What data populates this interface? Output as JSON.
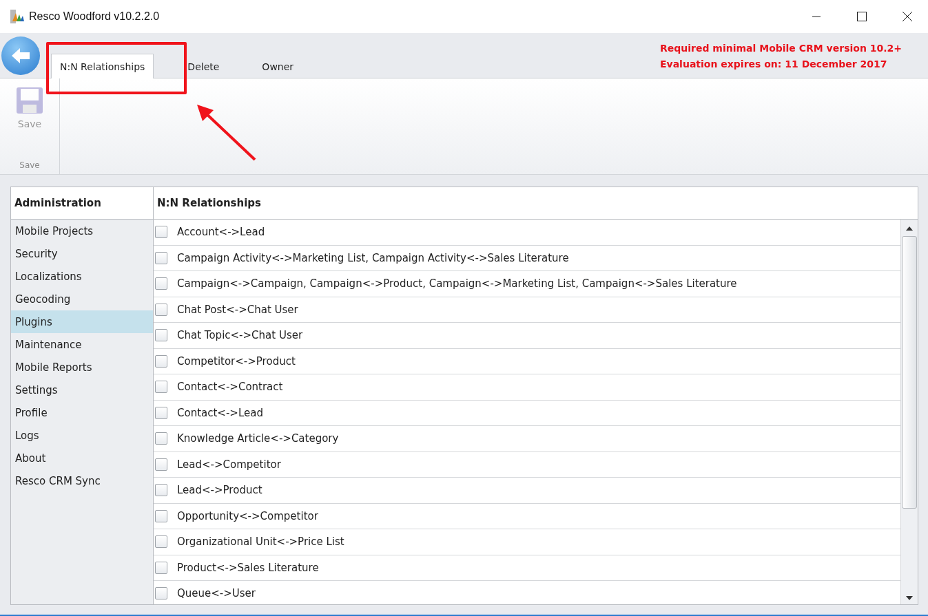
{
  "window": {
    "title": "Resco Woodford v10.2.2.0"
  },
  "tabs": [
    {
      "label": "N:N Relationships",
      "selected": true
    },
    {
      "label": "Delete",
      "selected": false
    },
    {
      "label": "Owner",
      "selected": false
    }
  ],
  "notices": [
    "Required minimal Mobile CRM version 10.2+",
    "Evaluation expires on: 11 December 2017"
  ],
  "ribbon": {
    "buttons": [
      {
        "label": "Save",
        "disabled": true
      }
    ],
    "group_label": "Save"
  },
  "sidebar": {
    "title": "Administration",
    "items": [
      {
        "label": "Mobile Projects",
        "selected": false
      },
      {
        "label": "Security",
        "selected": false
      },
      {
        "label": "Localizations",
        "selected": false
      },
      {
        "label": "Geocoding",
        "selected": false
      },
      {
        "label": "Plugins",
        "selected": true
      },
      {
        "label": "Maintenance",
        "selected": false
      },
      {
        "label": "Mobile Reports",
        "selected": false
      },
      {
        "label": "Settings",
        "selected": false
      },
      {
        "label": "Profile",
        "selected": false
      },
      {
        "label": "Logs",
        "selected": false
      },
      {
        "label": "About",
        "selected": false
      },
      {
        "label": "Resco CRM Sync",
        "selected": false
      }
    ]
  },
  "list": {
    "title": "N:N Relationships",
    "rows": [
      {
        "label": "Account<->Lead",
        "checked": false
      },
      {
        "label": "Campaign Activity<->Marketing List, Campaign Activity<->Sales Literature",
        "checked": false
      },
      {
        "label": "Campaign<->Campaign, Campaign<->Product, Campaign<->Marketing List, Campaign<->Sales Literature",
        "checked": false
      },
      {
        "label": "Chat Post<->Chat User",
        "checked": false
      },
      {
        "label": "Chat Topic<->Chat User",
        "checked": false
      },
      {
        "label": "Competitor<->Product",
        "checked": false
      },
      {
        "label": "Contact<->Contract",
        "checked": false
      },
      {
        "label": "Contact<->Lead",
        "checked": false
      },
      {
        "label": "Knowledge Article<->Category",
        "checked": false
      },
      {
        "label": "Lead<->Competitor",
        "checked": false
      },
      {
        "label": "Lead<->Product",
        "checked": false
      },
      {
        "label": "Opportunity<->Competitor",
        "checked": false
      },
      {
        "label": "Organizational Unit<->Price List",
        "checked": false
      },
      {
        "label": "Product<->Sales Literature",
        "checked": false
      },
      {
        "label": "Queue<->User",
        "checked": false
      }
    ]
  }
}
